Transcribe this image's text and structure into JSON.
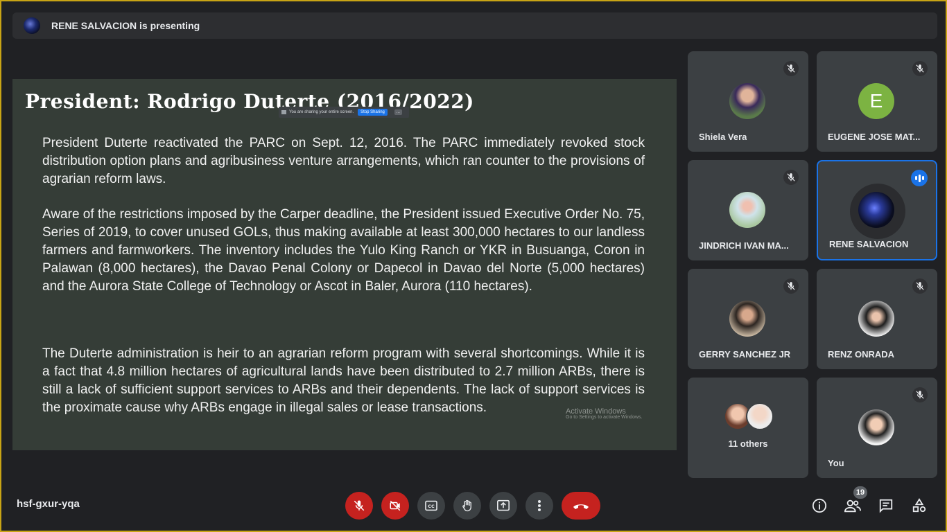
{
  "presenter_banner": {
    "text": "RENE SALVACION is presenting"
  },
  "slide": {
    "heading": "President: Rodrigo Duterte (2016/2022)",
    "paragraphs": [
      "President Duterte reactivated the PARC on Sept. 12, 2016. The PARC immediately revoked stock distribution option plans and agribusiness venture arrangements, which ran counter to the provisions of agrarian reform laws.",
      "Aware of the restrictions imposed by the Carper deadline, the President issued Executive Order No. 75, Series of 2019, to cover unused GOLs, thus making available at least 300,000 hectares to our landless farmers and farmworkers. The inventory includes the Yulo King Ranch or YKR in Busuanga, Coron in Palawan (8,000 hectares), the Davao Penal Colony or Dapecol in Davao del Norte (5,000 hectares) and the Aurora State College of Technology or Ascot in Baler, Aurora (110 hectares).",
      "The Duterte administration is heir to an agrarian reform program with several shortcomings. While it is a fact that 4.8 million hectares of agricultural lands have been distributed to 2.7 million ARBs, there is still a lack of sufficient support services to ARBs and their dependents. The lack of support services is the proximate cause why ARBs engage in illegal sales or lease transactions."
    ],
    "share_bar": {
      "text": "You are sharing your entire screen.",
      "stop": "Stop Sharing",
      "more": "..."
    },
    "watermark": {
      "line1": "Activate Windows",
      "line2": "Go to Settings to activate Windows."
    }
  },
  "participants": [
    {
      "name": "Shiela Vera",
      "muted": true
    },
    {
      "name": "EUGENE JOSE MAT...",
      "muted": true,
      "initial": "E"
    },
    {
      "name": "JINDRICH IVAN MA...",
      "muted": true
    },
    {
      "name": "RENE SALVACION",
      "muted": false,
      "speaking": true
    },
    {
      "name": "GERRY SANCHEZ JR",
      "muted": true
    },
    {
      "name": "RENZ ONRADA",
      "muted": true
    },
    {
      "name": "11 others"
    },
    {
      "name": "You",
      "muted": true
    }
  ],
  "meeting_code": "hsf-gxur-yqa",
  "people_count": "19",
  "colors": {
    "leave": "#c5221f",
    "accent": "#1a73e8",
    "slide_bg": "#353d37"
  },
  "controls": [
    "mic-off-icon",
    "camera-off-icon",
    "captions-icon",
    "raise-hand-icon",
    "present-icon",
    "more-options-icon",
    "leave-call-icon"
  ],
  "right_controls": [
    "info-icon",
    "people-icon",
    "chat-icon",
    "activities-icon"
  ]
}
